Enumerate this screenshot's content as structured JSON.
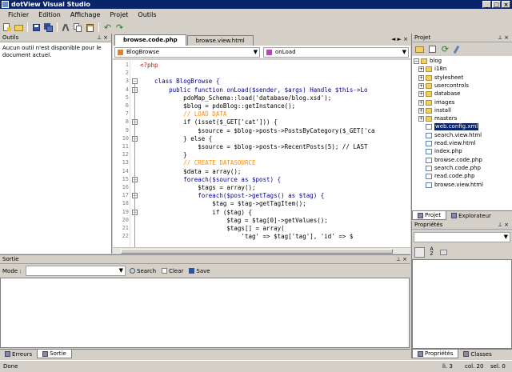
{
  "window": {
    "title": "dotView Visual Studio"
  },
  "menu": [
    "Fichier",
    "Edition",
    "Affichage",
    "Projet",
    "Outils"
  ],
  "outils": {
    "title": "Outils",
    "message": "Aucun outil n'est disponible pour le document actuel."
  },
  "editor": {
    "tabs": [
      "browse.code.php",
      "browse.view.html"
    ],
    "class_combo": "BlogBrowse",
    "method_combo": "onLoad",
    "lines": [
      {
        "n": "1",
        "text": "<?php",
        "cls": "st"
      },
      {
        "n": "2",
        "text": "",
        "cls": ""
      },
      {
        "n": "3",
        "text": "    class BlogBrowse {",
        "cls": "kw"
      },
      {
        "n": "4",
        "text": "        public function onLoad($sender, $args) Handle $this->Lo",
        "cls": "kw"
      },
      {
        "n": "5",
        "text": "            pdoMap_Schema::load('database/blog.xsd');",
        "cls": ""
      },
      {
        "n": "6",
        "text": "            $blog = pdoBlog::getInstance();",
        "cls": ""
      },
      {
        "n": "7",
        "text": "            // LOAD DATA",
        "cls": "cm"
      },
      {
        "n": "8",
        "text": "            if (isset($_GET['cat'])) {",
        "cls": ""
      },
      {
        "n": "9",
        "text": "                $source = $blog->posts->PostsByCategory($_GET['ca",
        "cls": ""
      },
      {
        "n": "10",
        "text": "            } else {",
        "cls": ""
      },
      {
        "n": "11",
        "text": "                $source = $blog->posts->RecentPosts(5); // LAST",
        "cls": ""
      },
      {
        "n": "12",
        "text": "            }",
        "cls": ""
      },
      {
        "n": "13",
        "text": "            // CREATE DATASOURCE",
        "cls": "cm"
      },
      {
        "n": "14",
        "text": "            $data = array();",
        "cls": ""
      },
      {
        "n": "15",
        "text": "            foreach($source as $post) {",
        "cls": "kw"
      },
      {
        "n": "16",
        "text": "                $tags = array();",
        "cls": ""
      },
      {
        "n": "17",
        "text": "                foreach($post->getTags() as $tag) {",
        "cls": "kw"
      },
      {
        "n": "18",
        "text": "                    $tag = $tag->getTagItem();",
        "cls": ""
      },
      {
        "n": "19",
        "text": "                    if ($tag) {",
        "cls": ""
      },
      {
        "n": "20",
        "text": "                        $tag = $tag[0]->getValues();",
        "cls": ""
      },
      {
        "n": "21",
        "text": "                        $tags[] = array(",
        "cls": ""
      },
      {
        "n": "22",
        "text": "                            'tag' => $tag['tag'], 'id' => $",
        "cls": ""
      }
    ]
  },
  "projet": {
    "title": "Projet",
    "root": "blog",
    "folders": [
      "i18n",
      "stylesheet",
      "usercontrols",
      "database",
      "images",
      "install",
      "masters"
    ],
    "files": [
      "web.config.xml",
      "search.view.html",
      "read.view.html",
      "index.php",
      "browse.code.php",
      "search.code.php",
      "read.code.php",
      "browse.view.html"
    ],
    "selected": "web.config.xml",
    "tabs": [
      "Projet",
      "Explorateur"
    ]
  },
  "proprietes": {
    "title": "Propriétés",
    "tabs": [
      "Propriétés",
      "Classes"
    ]
  },
  "sortie": {
    "title": "Sortie",
    "mode_label": "Mode :",
    "search_label": "Search",
    "clear_label": "Clear",
    "save_label": "Save",
    "tabs": [
      "Erreurs",
      "Sortie"
    ]
  },
  "status": {
    "text": "Done",
    "line": "li. 3",
    "col": "col. 20",
    "sel": "sel. 0"
  },
  "colors": {
    "title_bg": "#0a246a",
    "selection": "#0a246a",
    "keyword": "#00008b",
    "comment": "#ff8c00"
  }
}
